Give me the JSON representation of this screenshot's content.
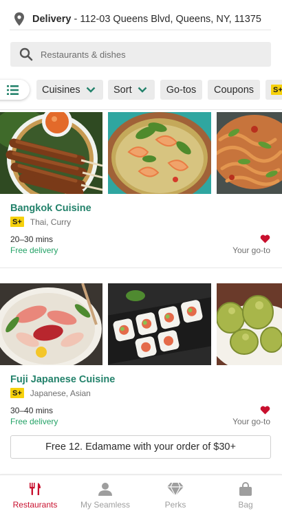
{
  "address": {
    "mode": "Delivery",
    "separator": " - ",
    "text": "112-03 Queens Blvd, Queens, NY, 11375",
    "icon": "location-pin-icon"
  },
  "search": {
    "placeholder": "Restaurants & dishes",
    "icon": "search-icon"
  },
  "filters": {
    "filter_icon": "sliders-icon",
    "chips": [
      {
        "label": "Cuisines",
        "has_dropdown": true
      },
      {
        "label": "Sort",
        "has_dropdown": true
      },
      {
        "label": "Go-tos",
        "has_dropdown": false
      },
      {
        "label": "Coupons",
        "has_dropdown": false
      },
      {
        "label": "S+",
        "has_dropdown": false
      }
    ]
  },
  "restaurants": [
    {
      "name": "Bangkok Cuisine",
      "badge": "S+",
      "cuisines": "Thai, Curry",
      "time": "20–30 mins",
      "fee": "Free delivery",
      "goto_label": "Your go-to",
      "photos": [
        "satay-skewers",
        "shrimp-curry",
        "pad-thai"
      ]
    },
    {
      "name": "Fuji Japanese Cuisine",
      "badge": "S+",
      "cuisines": "Japanese, Asian",
      "time": "30–40 mins",
      "fee": "Free delivery",
      "goto_label": "Your go-to",
      "photos": [
        "sashimi-platter",
        "sushi-rolls",
        "shumai-dumplings"
      ],
      "promo": "Free 12. Edamame with your order of $30+"
    }
  ],
  "nav": {
    "items": [
      {
        "label": "Restaurants",
        "icon": "fork-knife-icon",
        "active": true
      },
      {
        "label": "My Seamless",
        "icon": "person-icon",
        "active": false
      },
      {
        "label": "Perks",
        "icon": "diamond-icon",
        "active": false
      },
      {
        "label": "Bag",
        "icon": "bag-icon",
        "active": false
      }
    ]
  },
  "colors": {
    "brand_red": "#c8102e",
    "name_green": "#23826b",
    "fee_green": "#23a266",
    "badge_yellow": "#f6d10c"
  }
}
